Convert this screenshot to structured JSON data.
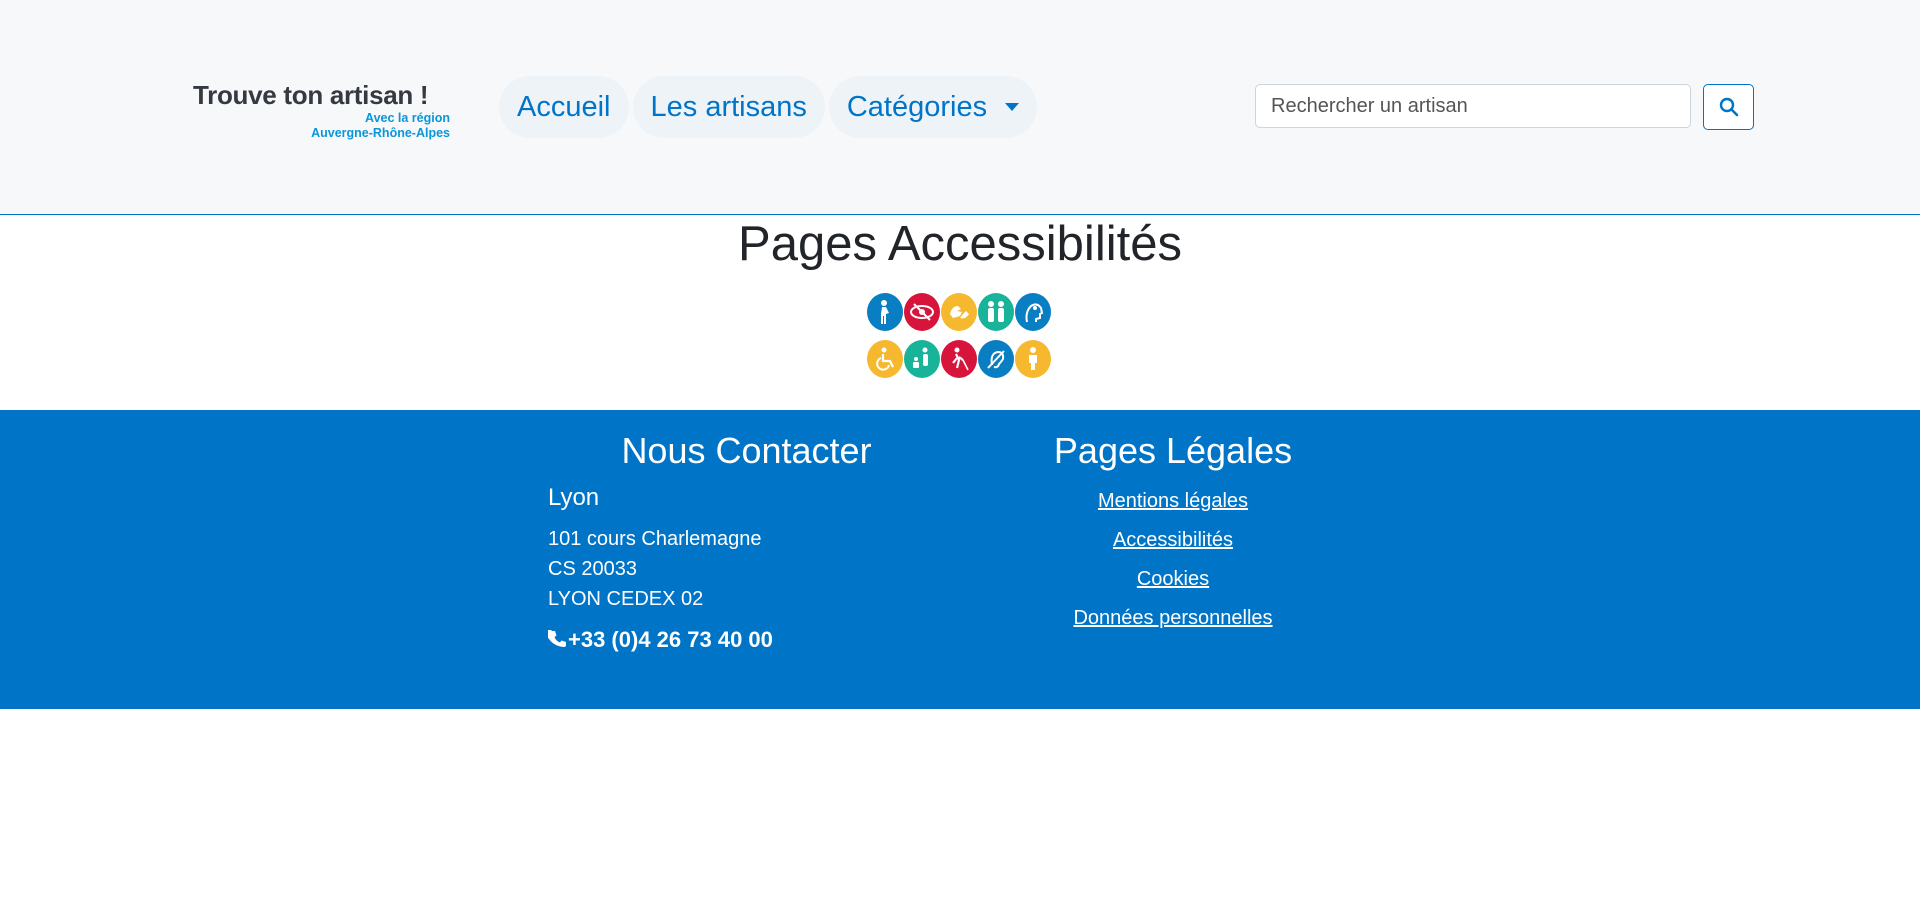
{
  "logo": {
    "title": "Trouve ton artisan !",
    "subtitle1": "Avec la région",
    "subtitle2": "Auvergne-Rhône-Alpes"
  },
  "nav": {
    "items": [
      {
        "label": "Accueil"
      },
      {
        "label": "Les artisans"
      },
      {
        "label": "Catégories",
        "icon": "caret-down-icon"
      }
    ]
  },
  "search": {
    "placeholder": "Rechercher un artisan",
    "icon": "search-icon"
  },
  "main": {
    "title": "Pages Accessibilités",
    "accessibility_icons": [
      {
        "icon": "pregnant-person-icon",
        "color": "#0a7ec2"
      },
      {
        "icon": "visual-impairment-icon",
        "color": "#d7143c"
      },
      {
        "icon": "sign-language-icon",
        "color": "#f5b82e"
      },
      {
        "icon": "seniors-icon",
        "color": "#19b39a"
      },
      {
        "icon": "mental-disability-icon",
        "color": "#0a7ec2"
      },
      {
        "icon": "wheelchair-icon",
        "color": "#f5b82e"
      },
      {
        "icon": "child-stroller-icon",
        "color": "#19b39a"
      },
      {
        "icon": "blind-cane-icon",
        "color": "#d7143c"
      },
      {
        "icon": "hearing-impairment-icon",
        "color": "#0a7ec2"
      },
      {
        "icon": "person-icon",
        "color": "#f5b82e"
      }
    ]
  },
  "footer": {
    "background": "#0074c7",
    "contact": {
      "title": "Nous Contacter",
      "city": "Lyon",
      "address_line1": "101 cours Charlemagne",
      "address_line2": "CS 20033",
      "address_line3": "LYON CEDEX 02",
      "phone": "+33 (0)4 26 73 40 00",
      "phone_icon": "phone-icon"
    },
    "legal": {
      "title": "Pages Légales",
      "links": [
        {
          "label": "Mentions légales"
        },
        {
          "label": "Accessibilités"
        },
        {
          "label": "Cookies"
        },
        {
          "label": "Données personnelles"
        }
      ]
    }
  },
  "colors": {
    "accent": "#0074c7",
    "header_bg": "#f6f8fa"
  }
}
